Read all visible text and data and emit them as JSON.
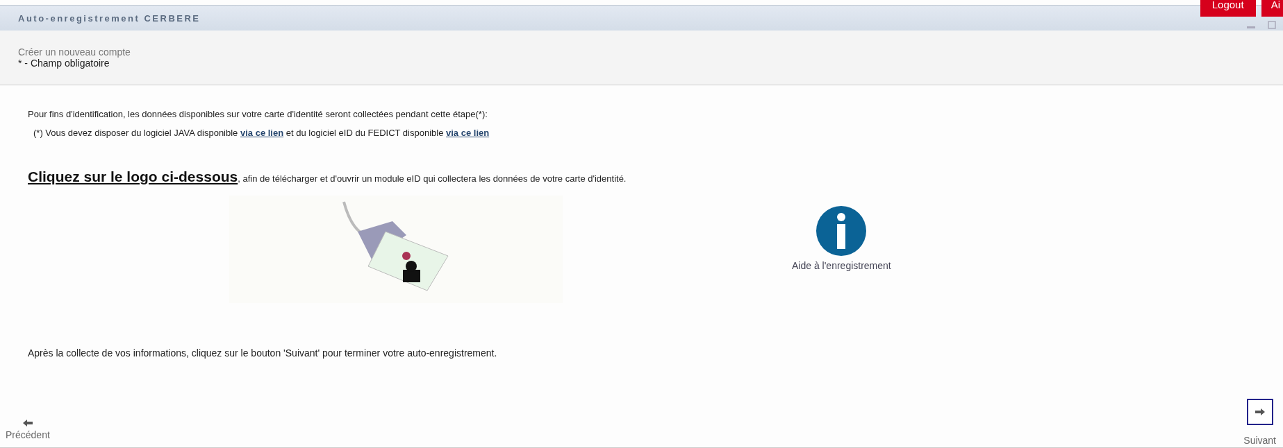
{
  "header": {
    "title": "Auto-enregistrement CERBERE",
    "buttons": [
      "Logout",
      "Ai"
    ]
  },
  "subheader": {
    "title": "Créer un nouveau compte",
    "note": "* - Champ obligatoire"
  },
  "intro": "Pour fins d'identification, les données disponibles sur votre carte d'identité seront collectées pendant cette étape(*):",
  "requirement": {
    "parts": [
      "(*) Vous devez disposer du logiciel JAVA disponible ",
      "via ce lien",
      " et du logiciel eID du FEDICT disponible ",
      "via ce lien"
    ]
  },
  "instruction": {
    "link": "Cliquez sur le logo ci-dessous",
    "rest": ", afin de télécharger et d'ouvrir un module eID qui collectera les données de votre carte d'identité."
  },
  "help_label": "Aide à l'enregistrement",
  "after": "Après la collecte de vos informations, cliquez sur le bouton 'Suivant' pour terminer votre auto-enregistrement.",
  "nav": {
    "previous": "Précédent",
    "next": "Suivant"
  }
}
